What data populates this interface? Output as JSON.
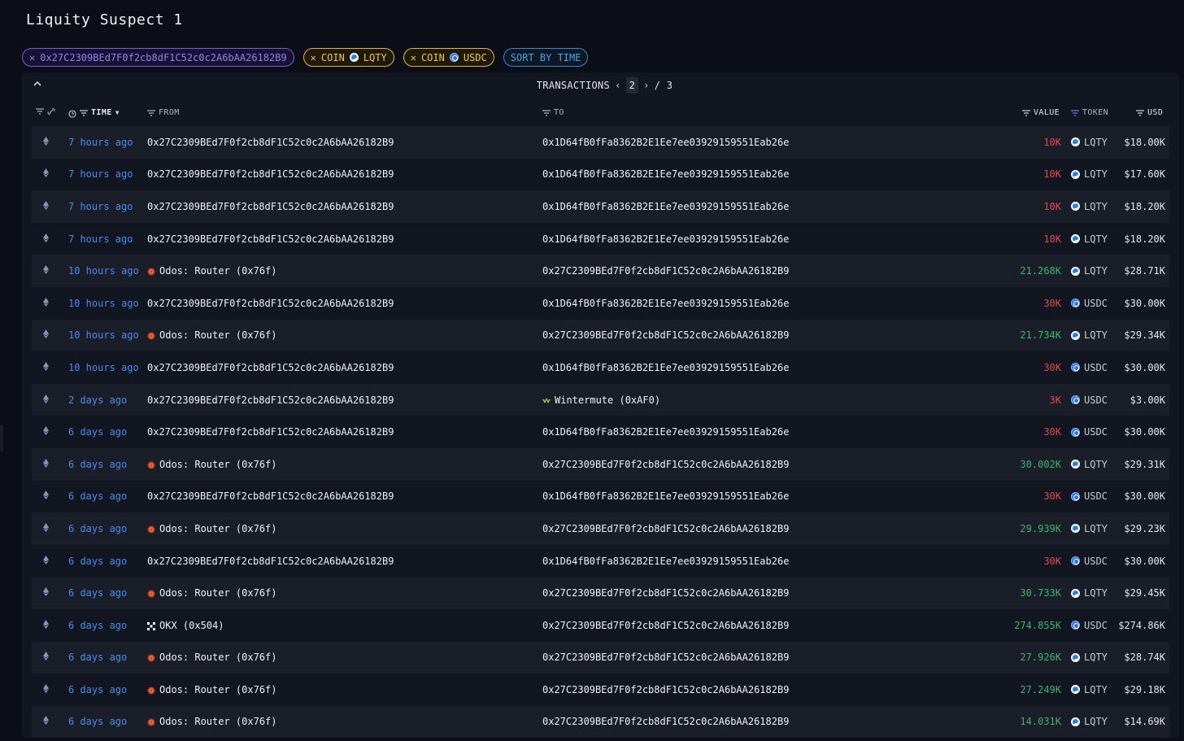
{
  "page_title": "Liquity Suspect 1",
  "filters": {
    "address": "0x27C2309BEd7F0f2cb8dF1C52c0c2A6bAA26182B9",
    "coin_label": "COIN",
    "coin1": "LQTY",
    "coin2": "USDC",
    "sort_label": "SORT BY TIME"
  },
  "transactions": {
    "title": "TRANSACTIONS",
    "page": "2",
    "total": "/ 3"
  },
  "columns": {
    "time": "TIME",
    "from": "FROM",
    "to": "TO",
    "value": "VALUE",
    "token": "TOKEN",
    "usd": "USD"
  },
  "colors": {
    "background": "#0b0e16",
    "panel": "#121620",
    "time_link": "#4c8bf0",
    "value_out": "#e5484d",
    "value_in": "#3fb66c",
    "address_chip": "#7b5bd6",
    "coin_chip": "#e3b63a",
    "sort_chip": "#3b87c8"
  },
  "rows": [
    {
      "time": "7 hours ago",
      "from": "0x27C2309BEd7F0f2cb8dF1C52c0c2A6bAA26182B9",
      "from_icon": "",
      "to": "0x1D64fB0fFa8362B2E1Ee7ee03929159551Eab26e",
      "to_icon": "",
      "value": "10K",
      "dir": "out",
      "token": "LQTY",
      "usd": "$18.00K"
    },
    {
      "time": "7 hours ago",
      "from": "0x27C2309BEd7F0f2cb8dF1C52c0c2A6bAA26182B9",
      "from_icon": "",
      "to": "0x1D64fB0fFa8362B2E1Ee7ee03929159551Eab26e",
      "to_icon": "",
      "value": "10K",
      "dir": "out",
      "token": "LQTY",
      "usd": "$17.60K"
    },
    {
      "time": "7 hours ago",
      "from": "0x27C2309BEd7F0f2cb8dF1C52c0c2A6bAA26182B9",
      "from_icon": "",
      "to": "0x1D64fB0fFa8362B2E1Ee7ee03929159551Eab26e",
      "to_icon": "",
      "value": "10K",
      "dir": "out",
      "token": "LQTY",
      "usd": "$18.20K"
    },
    {
      "time": "7 hours ago",
      "from": "0x27C2309BEd7F0f2cb8dF1C52c0c2A6bAA26182B9",
      "from_icon": "",
      "to": "0x1D64fB0fFa8362B2E1Ee7ee03929159551Eab26e",
      "to_icon": "",
      "value": "10K",
      "dir": "out",
      "token": "LQTY",
      "usd": "$18.20K"
    },
    {
      "time": "10 hours ago",
      "from": "Odos: Router (0x76f)",
      "from_icon": "odos",
      "to": "0x27C2309BEd7F0f2cb8dF1C52c0c2A6bAA26182B9",
      "to_icon": "",
      "value": "21.268K",
      "dir": "in",
      "token": "LQTY",
      "usd": "$28.71K"
    },
    {
      "time": "10 hours ago",
      "from": "0x27C2309BEd7F0f2cb8dF1C52c0c2A6bAA26182B9",
      "from_icon": "",
      "to": "0x1D64fB0fFa8362B2E1Ee7ee03929159551Eab26e",
      "to_icon": "",
      "value": "30K",
      "dir": "out",
      "token": "USDC",
      "usd": "$30.00K"
    },
    {
      "time": "10 hours ago",
      "from": "Odos: Router (0x76f)",
      "from_icon": "odos",
      "to": "0x27C2309BEd7F0f2cb8dF1C52c0c2A6bAA26182B9",
      "to_icon": "",
      "value": "21.734K",
      "dir": "in",
      "token": "LQTY",
      "usd": "$29.34K"
    },
    {
      "time": "10 hours ago",
      "from": "0x27C2309BEd7F0f2cb8dF1C52c0c2A6bAA26182B9",
      "from_icon": "",
      "to": "0x1D64fB0fFa8362B2E1Ee7ee03929159551Eab26e",
      "to_icon": "",
      "value": "30K",
      "dir": "out",
      "token": "USDC",
      "usd": "$30.00K"
    },
    {
      "time": "2 days ago",
      "from": "0x27C2309BEd7F0f2cb8dF1C52c0c2A6bAA26182B9",
      "from_icon": "",
      "to": "Wintermute (0xAF0)",
      "to_icon": "wintermute",
      "value": "3K",
      "dir": "out",
      "token": "USDC",
      "usd": "$3.00K"
    },
    {
      "time": "6 days ago",
      "from": "0x27C2309BEd7F0f2cb8dF1C52c0c2A6bAA26182B9",
      "from_icon": "",
      "to": "0x1D64fB0fFa8362B2E1Ee7ee03929159551Eab26e",
      "to_icon": "",
      "value": "30K",
      "dir": "out",
      "token": "USDC",
      "usd": "$30.00K"
    },
    {
      "time": "6 days ago",
      "from": "Odos: Router (0x76f)",
      "from_icon": "odos",
      "to": "0x27C2309BEd7F0f2cb8dF1C52c0c2A6bAA26182B9",
      "to_icon": "",
      "value": "30.002K",
      "dir": "in",
      "token": "LQTY",
      "usd": "$29.31K"
    },
    {
      "time": "6 days ago",
      "from": "0x27C2309BEd7F0f2cb8dF1C52c0c2A6bAA26182B9",
      "from_icon": "",
      "to": "0x1D64fB0fFa8362B2E1Ee7ee03929159551Eab26e",
      "to_icon": "",
      "value": "30K",
      "dir": "out",
      "token": "USDC",
      "usd": "$30.00K"
    },
    {
      "time": "6 days ago",
      "from": "Odos: Router (0x76f)",
      "from_icon": "odos",
      "to": "0x27C2309BEd7F0f2cb8dF1C52c0c2A6bAA26182B9",
      "to_icon": "",
      "value": "29.939K",
      "dir": "in",
      "token": "LQTY",
      "usd": "$29.23K"
    },
    {
      "time": "6 days ago",
      "from": "0x27C2309BEd7F0f2cb8dF1C52c0c2A6bAA26182B9",
      "from_icon": "",
      "to": "0x1D64fB0fFa8362B2E1Ee7ee03929159551Eab26e",
      "to_icon": "",
      "value": "30K",
      "dir": "out",
      "token": "USDC",
      "usd": "$30.00K"
    },
    {
      "time": "6 days ago",
      "from": "Odos: Router (0x76f)",
      "from_icon": "odos",
      "to": "0x27C2309BEd7F0f2cb8dF1C52c0c2A6bAA26182B9",
      "to_icon": "",
      "value": "30.733K",
      "dir": "in",
      "token": "LQTY",
      "usd": "$29.45K"
    },
    {
      "time": "6 days ago",
      "from": "OKX (0x504)",
      "from_icon": "okx",
      "to": "0x27C2309BEd7F0f2cb8dF1C52c0c2A6bAA26182B9",
      "to_icon": "",
      "value": "274.855K",
      "dir": "in",
      "token": "USDC",
      "usd": "$274.86K"
    },
    {
      "time": "6 days ago",
      "from": "Odos: Router (0x76f)",
      "from_icon": "odos",
      "to": "0x27C2309BEd7F0f2cb8dF1C52c0c2A6bAA26182B9",
      "to_icon": "",
      "value": "27.926K",
      "dir": "in",
      "token": "LQTY",
      "usd": "$28.74K"
    },
    {
      "time": "6 days ago",
      "from": "Odos: Router (0x76f)",
      "from_icon": "odos",
      "to": "0x27C2309BEd7F0f2cb8dF1C52c0c2A6bAA26182B9",
      "to_icon": "",
      "value": "27.249K",
      "dir": "in",
      "token": "LQTY",
      "usd": "$29.18K"
    },
    {
      "time": "6 days ago",
      "from": "Odos: Router (0x76f)",
      "from_icon": "odos",
      "to": "0x27C2309BEd7F0f2cb8dF1C52c0c2A6bAA26182B9",
      "to_icon": "",
      "value": "14.031K",
      "dir": "in",
      "token": "LQTY",
      "usd": "$14.69K"
    }
  ]
}
